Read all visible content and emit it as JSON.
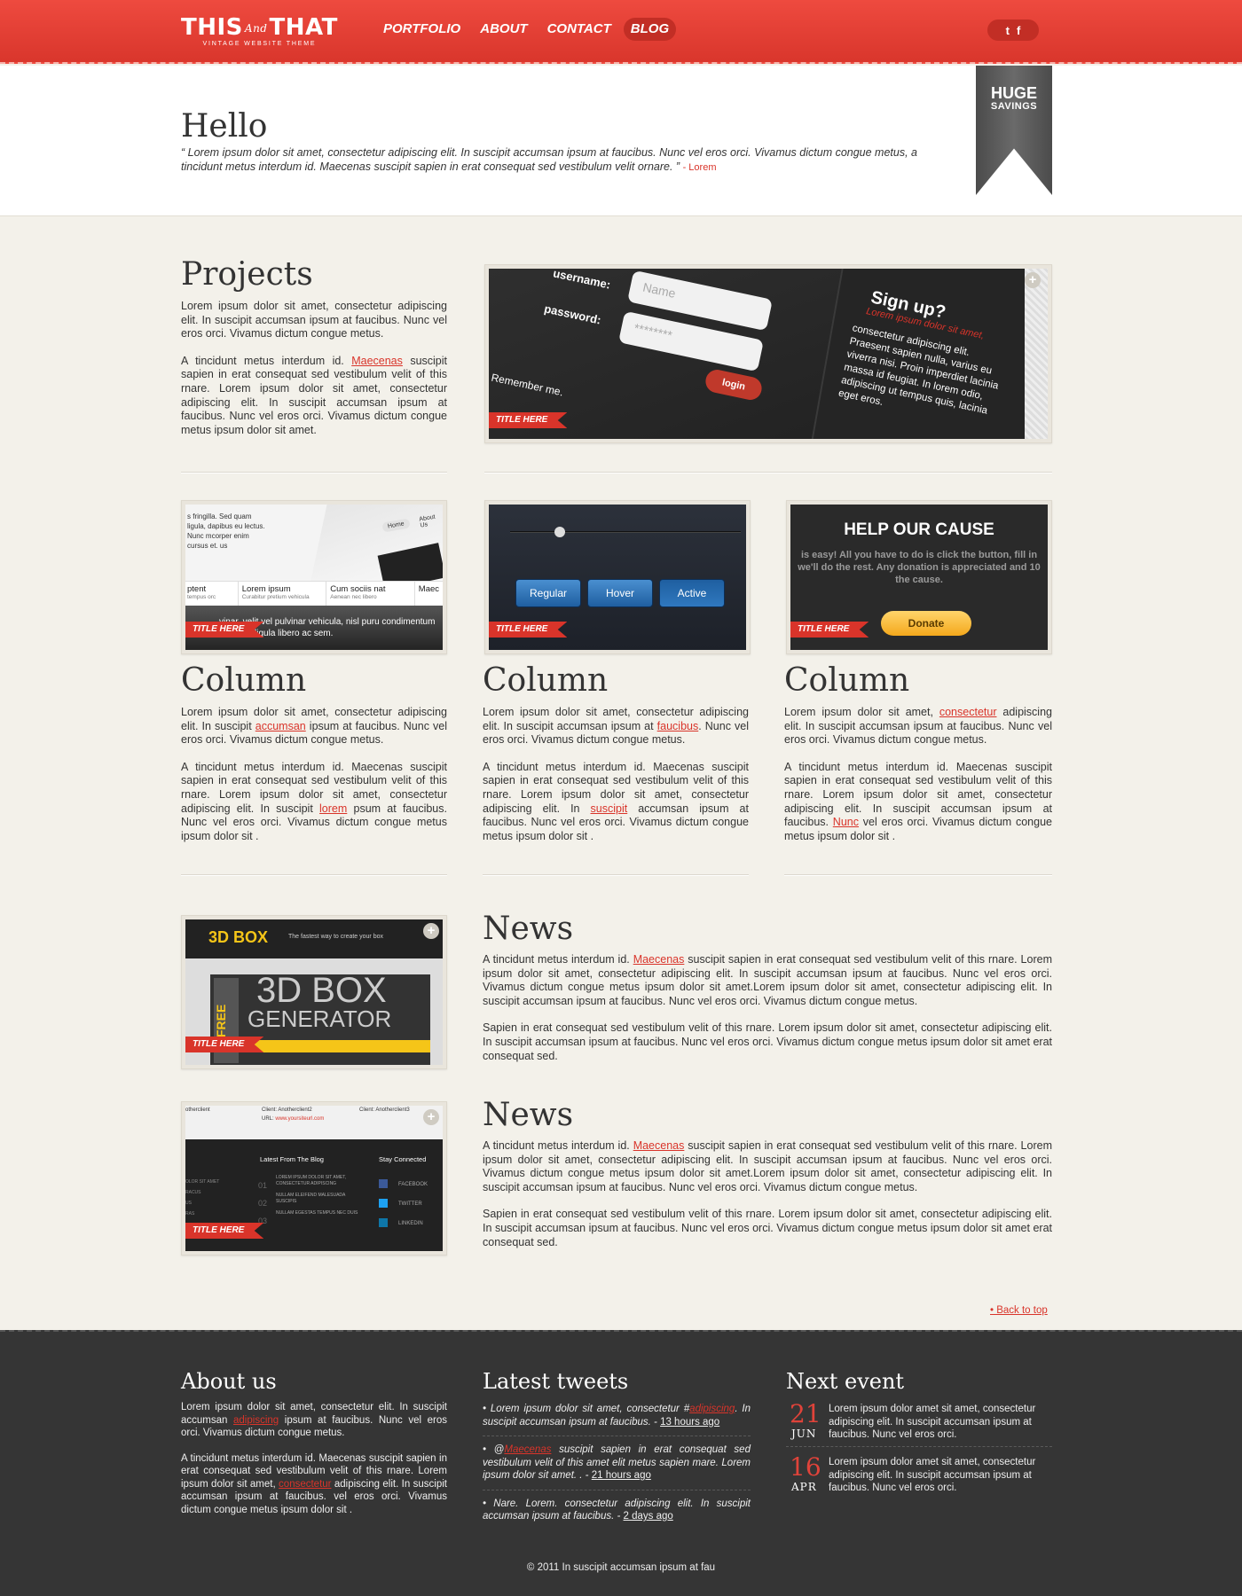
{
  "header": {
    "logo_main_a": "THIS",
    "logo_and": "And",
    "logo_main_b": "THAT",
    "logo_sub": "VINTAGE WEBSITE THEME",
    "nav": [
      "PORTFOLIO",
      "ABOUT",
      "CONTACT",
      "BLOG"
    ],
    "active_nav": "BLOG",
    "social": [
      "t",
      "f"
    ],
    "accent_color": "#e8473c"
  },
  "hero": {
    "title": "Hello",
    "quote": "“ Lorem ipsum dolor sit amet, consectetur adipiscing elit. In suscipit accumsan ipsum at faucibus. Nunc vel eros orci. Vivamus dictum congue metus, a tincidunt metus interdum id. Maecenas suscipit sapien in erat consequat sed vestibulum velit ornare. ”",
    "author": "- Lorem",
    "ribbon_a": "HUGE",
    "ribbon_b": "SAVINGS"
  },
  "projects": {
    "title": "Projects",
    "p1": "Lorem ipsum dolor sit amet, consectetur adipiscing elit. In suscipit accumsan ipsum at faucibus. Nunc vel eros orci. Vivamus dictum congue metus.",
    "p2a": "A tincidunt metus interdum id. ",
    "p2link": "Maecenas",
    "p2b": " suscipit sapien in erat consequat sed vestibulum velit of this rnare. Lorem ipsum dolor sit amet, consectetur adipiscing elit. In suscipit accumsan ipsum at faucibus. Nunc vel eros orci. Vivamus dictum congue metus ipsum dolor sit amet.",
    "image": {
      "username_label": "username:",
      "password_label": "password:",
      "name_placeholder": "Name",
      "password_placeholder": "********",
      "login_label": "login",
      "remember": "Remember me.",
      "signup_title": "Sign up?",
      "signup_sub": "Lorem ipsum dolor sit amet,",
      "signup_text": "consectetur adipiscing elit. Praesent sapien nulla, varius eu viverra nisi. Proin imperdiet lacinia massa id feugiat. In lorem odio, adipiscing ut tempus quis, lacinia eget eros.",
      "tag": "TITLE HERE"
    }
  },
  "columns": [
    {
      "title": "Column",
      "p1a": "Lorem ipsum dolor sit amet, consectetur adipiscing elit. In suscipit ",
      "p1link": "accumsan",
      "p1b": " ipsum at faucibus. Nunc vel eros orci. Vivamus dictum congue metus.",
      "p2a": "A tincidunt metus interdum id. Maecenas suscipit sapien in erat consequat sed vestibulum velit of this rnare. Lorem ipsum dolor sit amet, consectetur adipiscing elit. In suscipit ",
      "p2link": "lorem",
      "p2b": " psum at faucibus. Nunc vel eros orci. Vivamus dictum congue metus ipsum dolor sit .",
      "tag": "TITLE HERE",
      "img": {
        "text1": "s fringilla. Sed quam ligula, dapibus eu lectus. Nunc mcorper enim cursus et. us",
        "btn_home": "Home",
        "btn_about": "About Us",
        "c1": "ptent",
        "c1s": "tempus orc",
        "c2": "Lorem ipsum",
        "c2s": "Curabitur pretium vehicula",
        "c3": "Cum sociis nat",
        "c3s": "Aenean nec libero",
        "c4": "Maec",
        "bottom": "vinar, velit vel pulvinar vehicula, nisl puru condimentum pharetra ligula libero ac sem."
      }
    },
    {
      "title": "Column",
      "p1a": "Lorem ipsum dolor sit amet, consectetur adipiscing elit. In suscipit accumsan ipsum at ",
      "p1link": "faucibus",
      "p1b": ". Nunc vel eros orci. Vivamus dictum congue metus.",
      "p2a": "A tincidunt metus interdum id. Maecenas suscipit sapien in erat consequat sed vestibulum velit of this rnare. Lorem ipsum dolor sit amet, consectetur adipiscing elit. In ",
      "p2link": "suscipit",
      "p2b": " accumsan ipsum at faucibus. Nunc vel eros orci. Vivamus dictum congue metus ipsum dolor sit .",
      "tag": "TITLE HERE",
      "img": {
        "btn1": "Regular",
        "btn2": "Hover",
        "btn3": "Active"
      }
    },
    {
      "title": "Column",
      "p1a": "Lorem ipsum dolor sit amet, ",
      "p1link": "consectetur",
      "p1b": " adipiscing elit. In suscipit accumsan ipsum at faucibus. Nunc vel eros orci. Vivamus dictum congue metus.",
      "p2a": "A tincidunt metus interdum id. Maecenas suscipit sapien in erat consequat sed vestibulum velit of this rnare. Lorem ipsum dolor sit amet, consectetur adipiscing elit. In suscipit accumsan ipsum at faucibus. ",
      "p2link": "Nunc",
      "p2b": " vel eros orci. Vivamus dictum congue metus ipsum dolor sit .",
      "tag": "TITLE HERE",
      "img": {
        "heading": "HELP OUR CAUSE",
        "text": "is easy! All you have to do is click the button, fill in we'll do the rest. Any donation is appreciated and 10 the cause.",
        "donate": "Donate"
      }
    }
  ],
  "news": [
    {
      "title": "News",
      "p1a": "A tincidunt metus interdum id. ",
      "p1link": "Maecenas",
      "p1b": " suscipit sapien in erat consequat sed vestibulum velit of this rnare. Lorem ipsum dolor sit amet, consectetur adipiscing elit. In suscipit accumsan ipsum at faucibus. Nunc vel eros orci. Vivamus dictum congue metus ipsum dolor sit amet.Lorem ipsum dolor sit amet, consectetur adipiscing elit. In suscipit accumsan ipsum at faucibus. Nunc vel eros orci. Vivamus dictum congue metus.",
      "p2": "Sapien in erat consequat sed vestibulum velit of this rnare. Lorem ipsum dolor sit amet, consectetur adipiscing elit. In suscipit accumsan ipsum at faucibus. Nunc vel eros orci. Vivamus dictum congue metus ipsum dolor sit amet  erat consequat sed.",
      "tag": "TITLE HERE",
      "img": {
        "logo": "3D BOX",
        "tagline": "The fastest way to create your box",
        "big": "3D BOX",
        "big2": "GENERATOR",
        "free": "FREE"
      }
    },
    {
      "title": "News",
      "p1a": "A tincidunt metus interdum id. ",
      "p1link": "Maecenas",
      "p1b": " suscipit sapien in erat consequat sed vestibulum velit of this rnare. Lorem ipsum dolor sit amet, consectetur adipiscing elit. In suscipit accumsan ipsum at faucibus. Nunc vel eros orci. Vivamus dictum congue metus ipsum dolor sit amet.Lorem ipsum dolor sit amet, consectetur adipiscing elit. In suscipit accumsan ipsum at faucibus. Nunc vel eros orci. Vivamus dictum congue metus.",
      "p2": "Sapien in erat consequat sed vestibulum velit of this rnare. Lorem ipsum dolor sit amet, consectetur adipiscing elit. In suscipit accumsan ipsum at faucibus. Nunc vel eros orci. Vivamus dictum congue metus ipsum dolor sit amet  erat consequat sed.",
      "tag": "TITLE HERE",
      "img": {
        "client1": "otherclient",
        "client2": "Client: Anotherclient2",
        "client3": "Client: Anotherclient3",
        "url_label": "URL:",
        "url_value": "www.yoursiteurl.com",
        "blog_head": "Latest From The Blog",
        "stay_head": "Stay Connected",
        "left1": "OLOR SIT AMET",
        "left2": "RACUS",
        "left3": "US",
        "left4": "RAS",
        "n1": "01",
        "n2": "02",
        "n3": "03",
        "post1": "LOREM IPSUM DOLOR SIT AMET, CONSECTETUR ADIPISCING",
        "post2": "NULLAM ELEIFEND MALESUADA SUSCIPIS",
        "post3": "NULLAM EGESTAS TEMPUS NEC DUIS",
        "s1": "FACEBOOK",
        "s2": "TWITTER",
        "s3": "LINKEDIN"
      }
    }
  ],
  "back_to_top": "• Back to top",
  "footer": {
    "about_title": "About us",
    "about_p1a": "Lorem ipsum dolor sit amet, consectetur elit. In suscipit accumsan ",
    "about_p1link": "adipiscing",
    "about_p1b": " ipsum at faucibus. Nunc vel eros orci. Vivamus dictum congue metus.",
    "about_p2a": "A tincidunt metus interdum id. Maecenas suscipit sapien in erat consequat sed vestibulum velit of this rnare. Lorem ipsum dolor sit amet, ",
    "about_p2link": "consectetur",
    "about_p2b": " adipiscing elit. In suscipit accumsan ipsum at faucibus. vel eros orci. Vivamus dictum congue metus ipsum dolor sit .",
    "tweets_title": "Latest tweets",
    "tweets": [
      {
        "a": "• Lorem ipsum dolor sit amet, consectetur #",
        "link": "adipiscing",
        "b": ". In suscipit accumsan ipsum at faucibus. - ",
        "time": "13 hours ago"
      },
      {
        "a": "• @",
        "link": "Maecenas",
        "b": " suscipit sapien in erat consequat sed vestibulum velit of this amet elit metus sapien mare. Lorem ipsum dolor sit amet. . - ",
        "time": "21 hours ago"
      },
      {
        "a": "• Nare. Lorem. consectetur adipiscing elit. In suscipit accumsan ipsum at faucibus. - ",
        "link": "",
        "b": "",
        "time": "2 days ago"
      }
    ],
    "event_title": "Next event",
    "events": [
      {
        "day": "21",
        "month": "JUN",
        "text": "Lorem ipsum dolor amet sit amet, consectetur adipiscing elit. In suscipit accumsan ipsum at faucibus. Nunc vel eros orci."
      },
      {
        "day": "16",
        "month": "APR",
        "text": "Lorem ipsum dolor amet sit amet, consectetur adipiscing elit. In suscipit accumsan ipsum at faucibus. Nunc vel eros orci."
      }
    ],
    "copyright": "© 2011 In suscipit accumsan ipsum at fau"
  }
}
